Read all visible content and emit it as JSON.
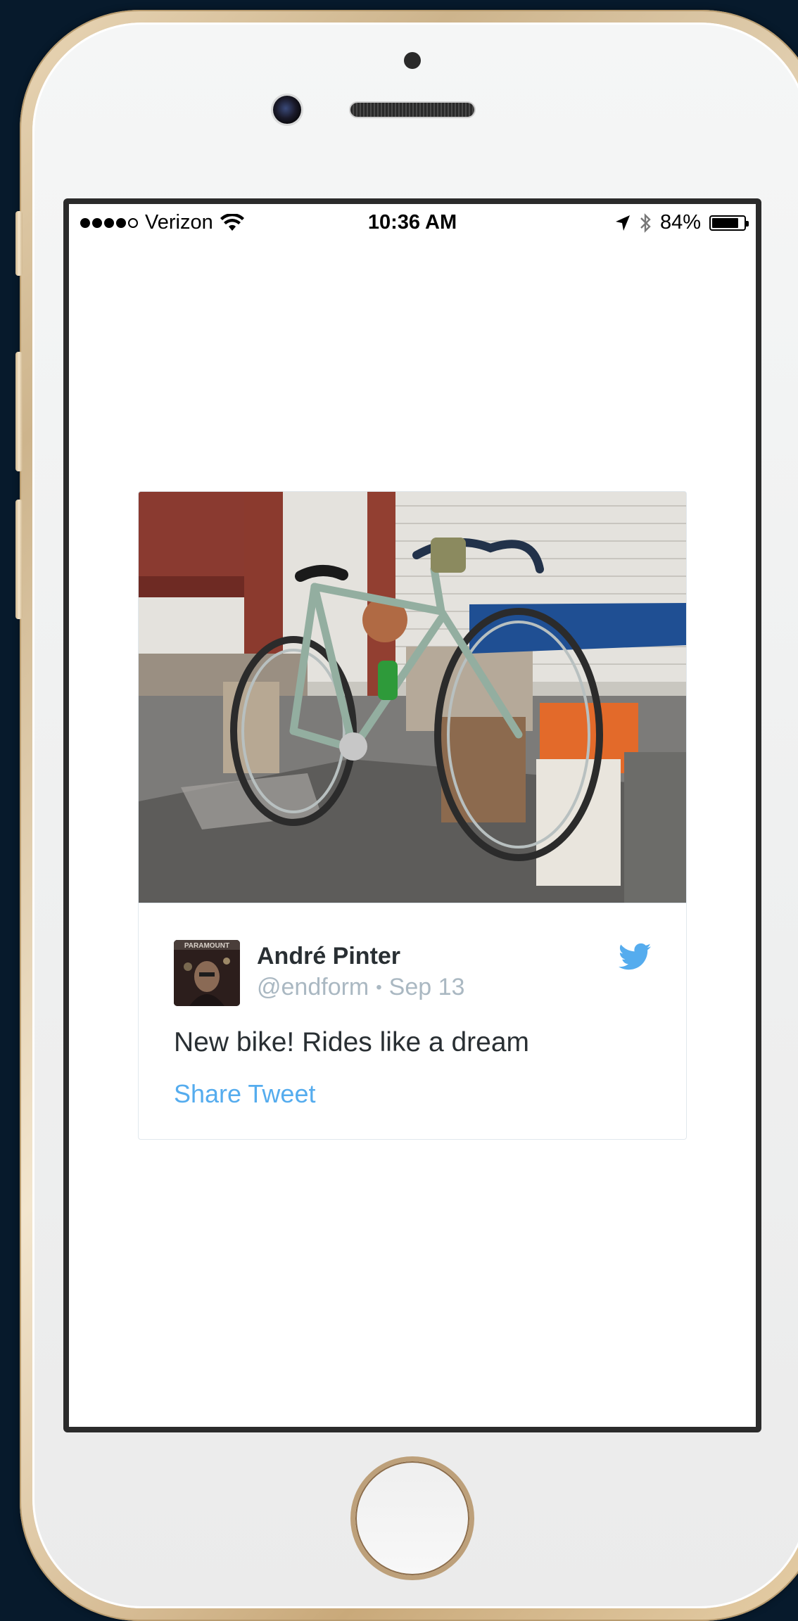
{
  "status_bar": {
    "carrier": "Verizon",
    "time": "10:36 AM",
    "battery": "84%",
    "battery_level": 0.84
  },
  "tweet": {
    "author_name": "André Pinter",
    "handle": "@endform",
    "separator": "•",
    "date": "Sep 13",
    "text": "New bike! Rides like a dream",
    "share_label": "Share Tweet",
    "avatar_text": "PARAMOUNT"
  },
  "colors": {
    "twitter_blue": "#55acee",
    "text_dark": "#292f33",
    "text_muted": "#aab8c2",
    "phone_gold": "#d9bf97"
  },
  "icons": {
    "wifi": "wifi-icon",
    "location": "location-arrow-icon",
    "bluetooth": "bluetooth-icon",
    "battery": "battery-icon",
    "twitter": "twitter-bird-icon"
  }
}
